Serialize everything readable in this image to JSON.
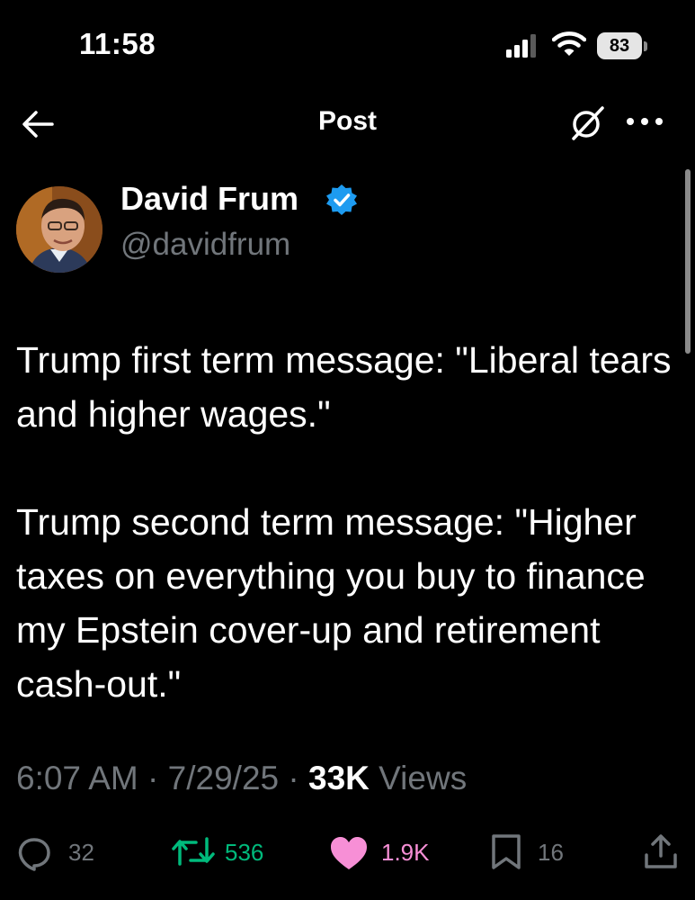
{
  "status_bar": {
    "time": "11:58",
    "battery": "83"
  },
  "header": {
    "title": "Post"
  },
  "author": {
    "name": "David Frum",
    "handle": "@davidfrum"
  },
  "tweet": {
    "paragraphs": [
      "Trump first term message: \"Liberal tears and higher wages.\"",
      "Trump second term message: \"Higher taxes on everything you buy to finance my Epstein cover-up and retirement cash-out.\""
    ]
  },
  "meta": {
    "time": "6:07 AM",
    "date": "7/29/25",
    "views_count": "33K",
    "views_label": "Views",
    "separator": "·"
  },
  "actions": {
    "replies": "32",
    "reposts": "536",
    "likes": "1.9K",
    "bookmarks": "16"
  },
  "colors": {
    "like": "#f91880",
    "repost": "#00ba7c",
    "verified": "#1d9bf0",
    "muted": "#71767b"
  }
}
